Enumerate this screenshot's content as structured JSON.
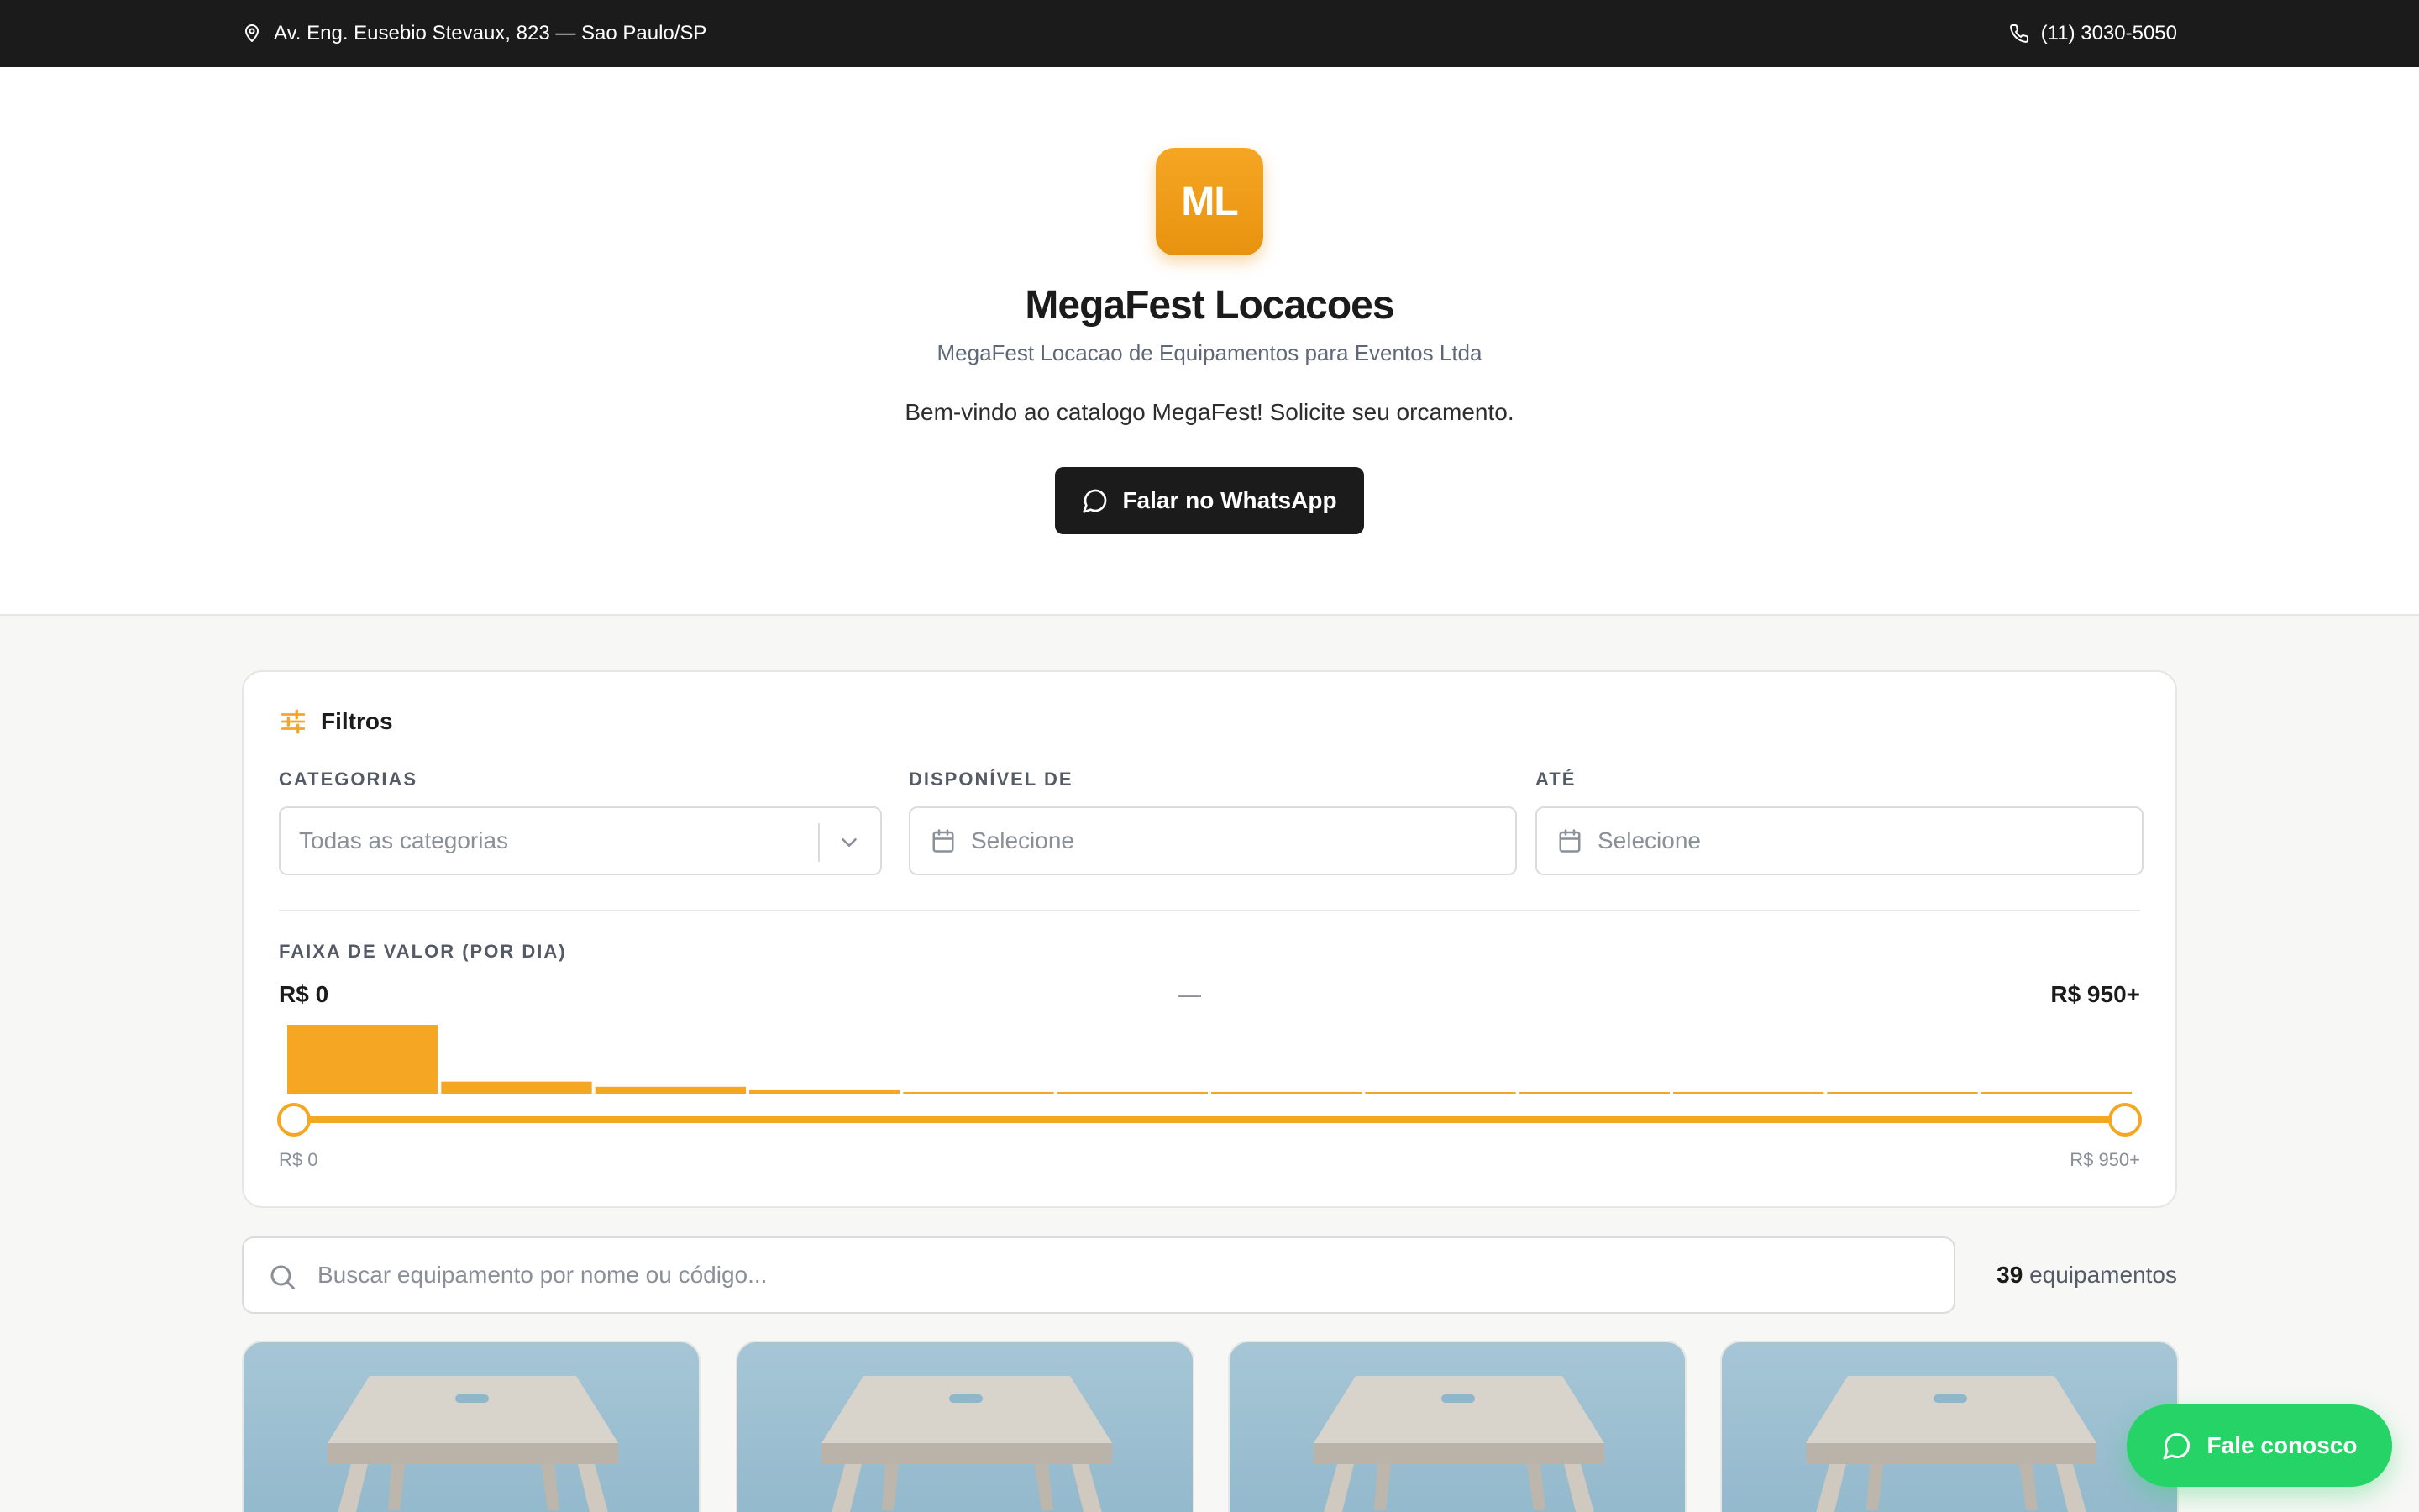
{
  "topbar": {
    "address": "Av. Eng. Eusebio Stevaux, 823 — Sao Paulo/SP",
    "phone": "(11) 3030-5050"
  },
  "hero": {
    "logo_text": "ML",
    "title": "MegaFest Locacoes",
    "subtitle": "MegaFest Locacao de Equipamentos para Eventos Ltda",
    "welcome": "Bem-vindo ao catalogo MegaFest! Solicite seu orcamento.",
    "whatsapp_label": "Falar no WhatsApp"
  },
  "filters": {
    "heading": "Filtros",
    "categories_label": "CATEGORIAS",
    "categories_value": "Todas as categorias",
    "from_label": "DISPONÍVEL DE",
    "from_placeholder": "Selecione",
    "to_label": "ATÉ",
    "to_placeholder": "Selecione",
    "range_label": "FAIXA DE VALOR (POR DIA)",
    "range_min": "R$ 0",
    "range_sep": "—",
    "range_max": "R$ 950+",
    "range_foot_min": "R$ 0",
    "range_foot_max": "R$ 950+",
    "histogram": [
      80,
      14,
      8,
      4,
      2,
      2,
      2,
      1,
      1,
      2,
      1,
      2
    ],
    "accent": "#f5a623"
  },
  "search": {
    "placeholder": "Buscar equipamento por nome ou código...",
    "count": "39",
    "count_suffix": "equipamentos"
  },
  "cards": [
    {
      "image": "wooden-stool"
    },
    {
      "image": "wooden-stool"
    },
    {
      "image": "wooden-stool"
    },
    {
      "image": "wooden-stool"
    }
  ],
  "fab": {
    "label": "Fale conosco",
    "color": "#25d366"
  },
  "icons": [
    "map-pin-icon",
    "phone-icon",
    "chat-icon",
    "sliders-icon",
    "chevron-down-icon",
    "calendar-icon",
    "search-icon"
  ]
}
